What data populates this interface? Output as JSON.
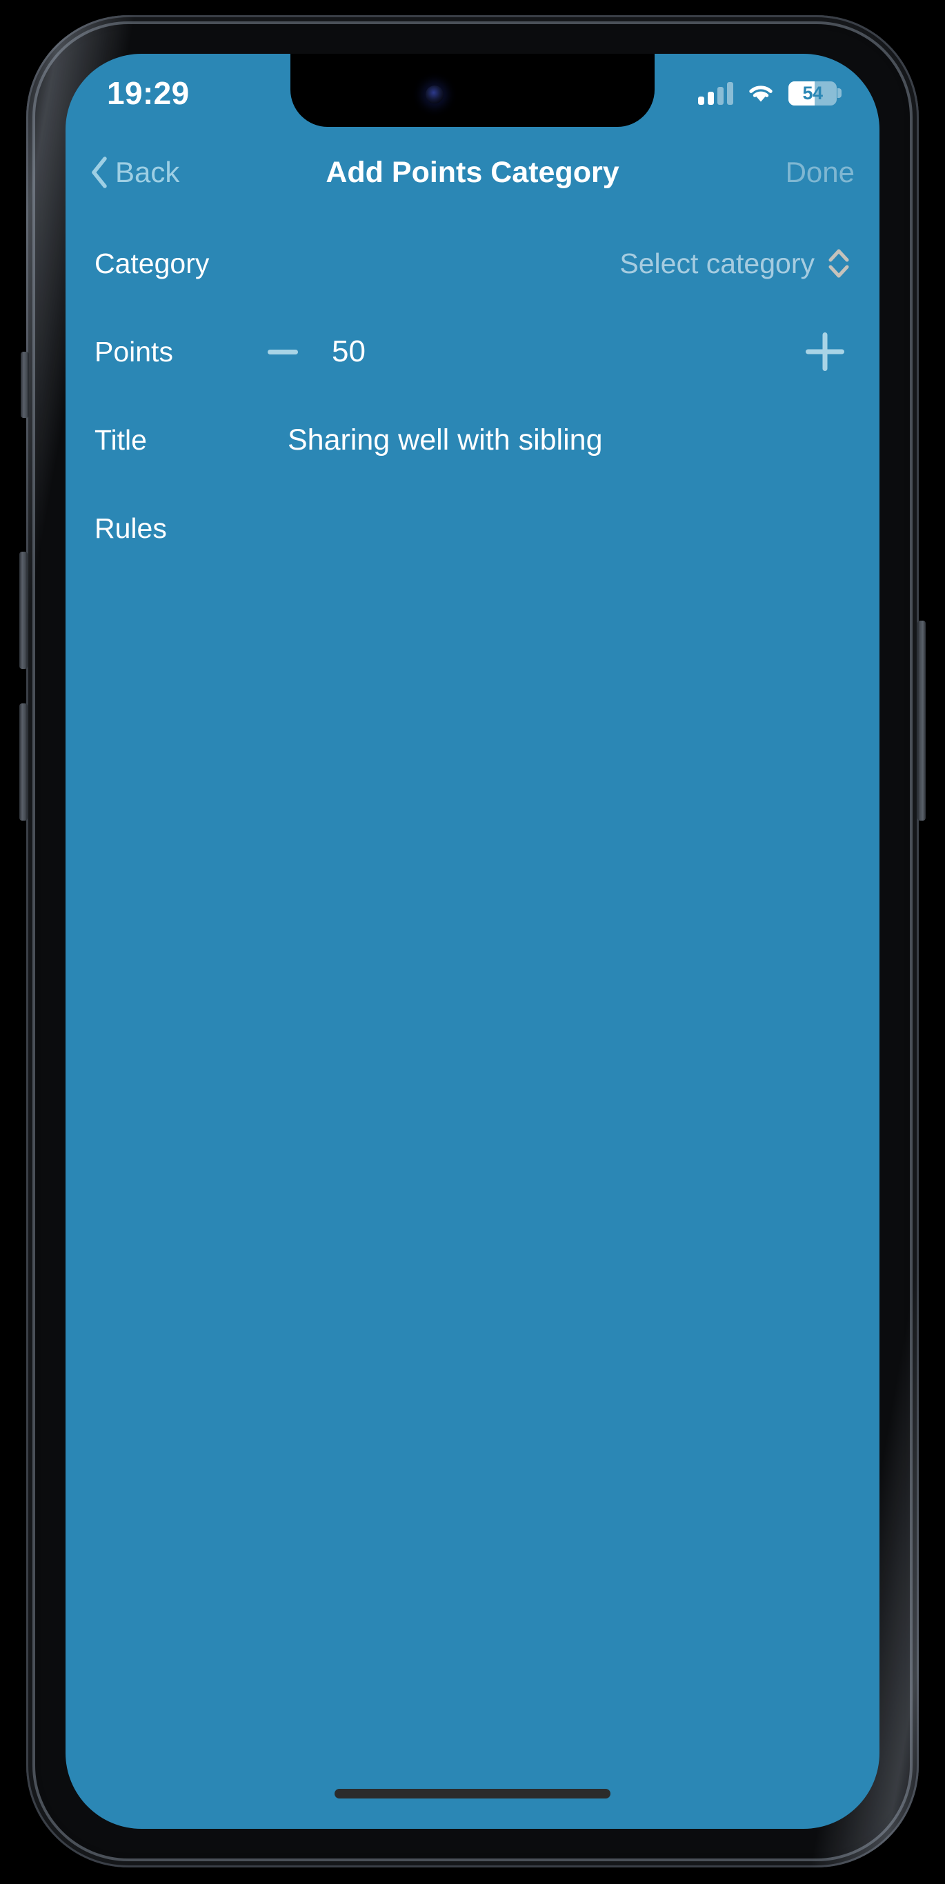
{
  "status_bar": {
    "time": "19:29",
    "signal_icon": "cellular-signal-icon",
    "signal_bars_filled": 2,
    "signal_bars_total": 4,
    "wifi_icon": "wifi-icon",
    "battery_icon": "battery-icon",
    "battery_level": "54",
    "battery_percent": 54
  },
  "nav_bar": {
    "back_label": "Back",
    "back_icon": "chevron-left-icon",
    "title": "Add Points Category",
    "done_label": "Done"
  },
  "form": {
    "rows": [
      {
        "label": "Category",
        "value": "",
        "placeholder": "Select category",
        "accessory_icon": "chevron-up-down-icon"
      },
      {
        "label": "Points",
        "value": "50",
        "minus_icon": "minus-icon",
        "plus_icon": "plus-icon"
      },
      {
        "label": "Title",
        "value": "Sharing well with sibling"
      },
      {
        "label": "Rules",
        "value": ""
      }
    ]
  },
  "colors": {
    "screen_background": "#2b87b5",
    "primary_text": "#ffffff",
    "muted_text": "rgba(255,255,255,0.58)",
    "disabled_text": "rgba(255,255,255,0.40)",
    "back_tint": "#9ecfe4",
    "stepper_tint": "#a9d4e6",
    "picker_chevron": "#c6c2bb",
    "home_indicator": "#2b2b2b"
  },
  "home_indicator": {
    "name": "home-indicator"
  }
}
